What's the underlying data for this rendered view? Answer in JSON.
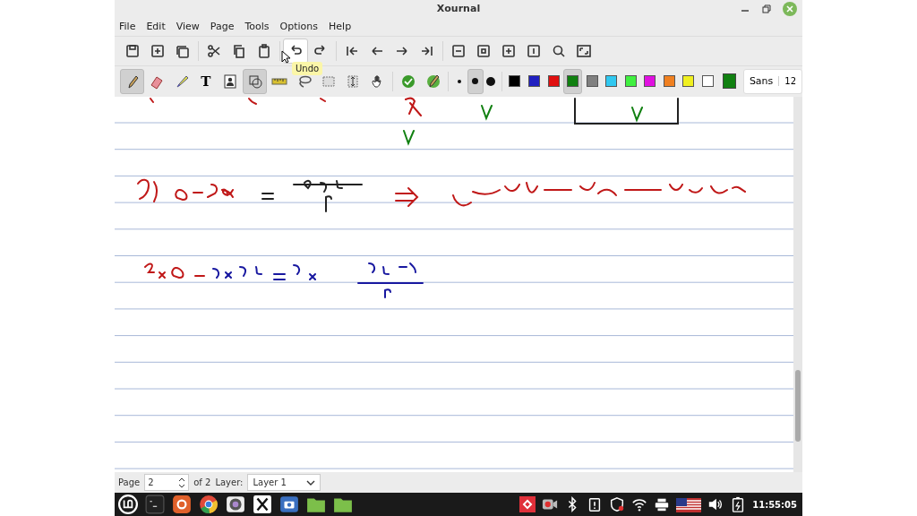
{
  "window": {
    "title": "Xournal"
  },
  "menu": [
    "File",
    "Edit",
    "View",
    "Page",
    "Tools",
    "Options",
    "Help"
  ],
  "main_toolbar": [
    {
      "kind": "save",
      "hovered": false
    },
    {
      "kind": "new-page",
      "hovered": false
    },
    {
      "kind": "pages",
      "hovered": false
    },
    {
      "kind": "cut",
      "hovered": false
    },
    {
      "kind": "copy",
      "hovered": false
    },
    {
      "kind": "paste",
      "hovered": false
    },
    {
      "kind": "undo",
      "hovered": true
    },
    {
      "kind": "redo",
      "hovered": false
    },
    {
      "kind": "first",
      "hovered": false
    },
    {
      "kind": "prev",
      "hovered": false
    },
    {
      "kind": "next",
      "hovered": false
    },
    {
      "kind": "last",
      "hovered": false
    },
    {
      "kind": "zoom-out",
      "hovered": false
    },
    {
      "kind": "zoom-fit",
      "hovered": false
    },
    {
      "kind": "zoom-in",
      "hovered": false
    },
    {
      "kind": "zoom-100",
      "hovered": false
    },
    {
      "kind": "search",
      "hovered": false
    },
    {
      "kind": "fullscreen",
      "hovered": false
    }
  ],
  "tooltip": "Undo",
  "tools": [
    {
      "kind": "pen",
      "selected": true
    },
    {
      "kind": "eraser",
      "selected": false
    },
    {
      "kind": "highlighter",
      "selected": false
    },
    {
      "kind": "text",
      "label": "T",
      "selected": false
    },
    {
      "kind": "image",
      "selected": false
    },
    {
      "kind": "shape",
      "selected": true
    },
    {
      "kind": "ruler",
      "selected": false
    },
    {
      "kind": "lasso",
      "selected": false
    },
    {
      "kind": "rect-select",
      "selected": false
    },
    {
      "kind": "vspace",
      "selected": false
    },
    {
      "kind": "hand",
      "selected": false
    },
    {
      "kind": "default",
      "selected": false
    },
    {
      "kind": "pen-default",
      "selected": false
    }
  ],
  "widths": [
    {
      "kind": "fine",
      "selected": false
    },
    {
      "kind": "medium",
      "selected": true
    },
    {
      "kind": "thick",
      "selected": false
    }
  ],
  "colors": [
    {
      "color": "#000000",
      "selected": false
    },
    {
      "color": "#2020c0",
      "selected": false
    },
    {
      "color": "#e01010",
      "selected": false
    },
    {
      "color": "#108010",
      "selected": true
    },
    {
      "color": "#808080",
      "selected": false
    },
    {
      "color": "#30c8f0",
      "selected": false
    },
    {
      "color": "#40f040",
      "selected": false
    },
    {
      "color": "#e010e0",
      "selected": false
    },
    {
      "color": "#f08020",
      "selected": false
    },
    {
      "color": "#f0f020",
      "selected": false
    },
    {
      "color": "#ffffff",
      "selected": false
    }
  ],
  "current_color": {
    "color": "#108010"
  },
  "font": {
    "name": "Sans",
    "size": "12"
  },
  "status_bar": {
    "page_label": "Page",
    "page_value": "2",
    "of_pages": "of 2",
    "layer_label": "Layer:",
    "layer_value": "Layer 1"
  },
  "taskbar": {
    "apps": [
      {
        "kind": "menu"
      },
      {
        "kind": "terminal"
      },
      {
        "kind": "firefox"
      },
      {
        "kind": "chrome"
      },
      {
        "kind": "webcam"
      },
      {
        "kind": "xournal"
      },
      {
        "kind": "screenshot"
      },
      {
        "kind": "folder"
      },
      {
        "kind": "folder"
      }
    ],
    "tray": [
      {
        "kind": "anydesk"
      },
      {
        "kind": "recorder"
      },
      {
        "kind": "bluetooth"
      },
      {
        "kind": "clipboard"
      },
      {
        "kind": "shield"
      },
      {
        "kind": "wifi"
      },
      {
        "kind": "printer"
      },
      {
        "kind": "flag"
      },
      {
        "kind": "volume"
      },
      {
        "kind": "battery"
      }
    ],
    "clock": "11:55:05"
  }
}
